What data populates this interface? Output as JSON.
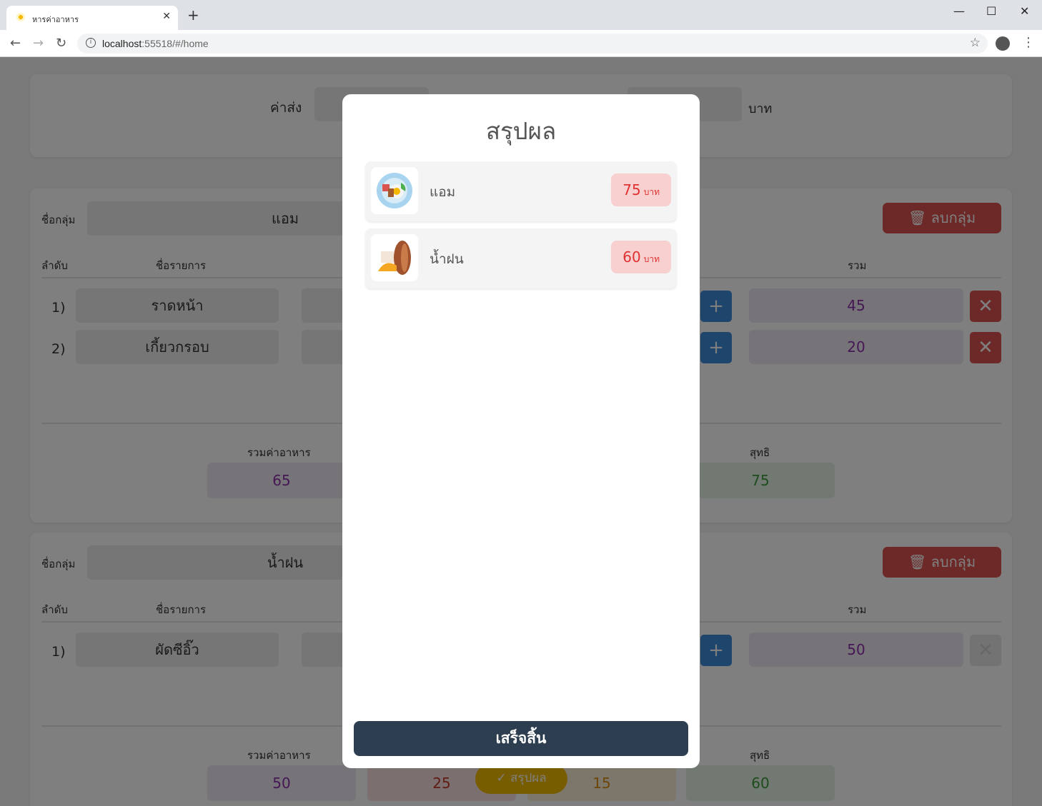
{
  "browser": {
    "tab_title": "หารค่าอาหาร",
    "tab_close": "✕",
    "new_tab": "+",
    "url_host": "localhost",
    "url_path": ":55518/#/home",
    "win_min": "—",
    "win_max": "☐",
    "win_close": "✕"
  },
  "page": {
    "delivery_label": "ค่าส่ง",
    "baht_label": "บาท",
    "groups": [
      {
        "group_label": "ชื่อกลุ่ม",
        "group_name": "แอม",
        "delete_group_label": "ลบกลุ่ม",
        "col_order": "ลำดับ",
        "col_item": "ชื่อรายการ",
        "col_total": "รวม",
        "items": [
          {
            "order": "1)",
            "name": "ราดหน้า",
            "total": "45"
          },
          {
            "order": "2)",
            "name": "เกี้ยวกรอบ",
            "total": "20"
          }
        ],
        "food_total_label": "รวมค่าอาหาร",
        "food_total": "65",
        "net_label": "สุทธิ",
        "net": "75"
      },
      {
        "group_label": "ชื่อกลุ่ม",
        "group_name": "น้ำฝน",
        "delete_group_label": "ลบกลุ่ม",
        "col_order": "ลำดับ",
        "col_item": "ชื่อรายการ",
        "col_total": "รวม",
        "items": [
          {
            "order": "1)",
            "name": "ผัดซีอิ๊ว",
            "total": "50"
          }
        ],
        "food_total_label": "รวมค่าอาหาร",
        "food_total": "50",
        "discount": "25",
        "delivery_share": "15",
        "net_label": "สุทธิ",
        "net": "60"
      }
    ],
    "summary_button": "สรุปผล"
  },
  "modal": {
    "title": "สรุปผล",
    "results": [
      {
        "name": "แอม",
        "amount": "75",
        "unit": "บาท",
        "icon": "plate-food-icon"
      },
      {
        "name": "น้ำฝน",
        "amount": "60",
        "unit": "บาท",
        "icon": "bread-food-icon"
      }
    ],
    "done_button": "เสร็จสิ้น"
  },
  "colors": {
    "done_button": "#2c3e50",
    "price_badge_bg": "#f8d0d0",
    "price_text": "#e03131"
  }
}
